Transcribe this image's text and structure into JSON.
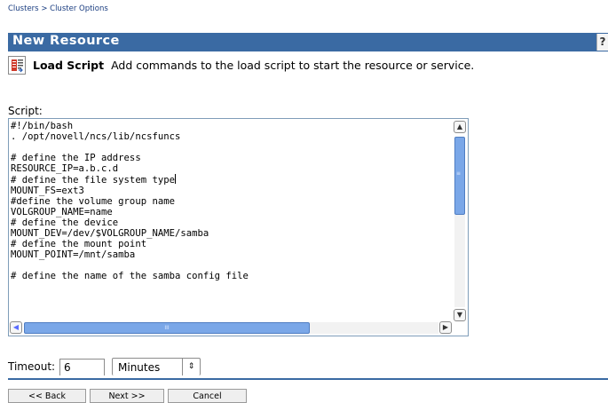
{
  "breadcrumb": {
    "root": "Clusters",
    "separator": ">",
    "current": "Cluster Options"
  },
  "page": {
    "title": "New Resource",
    "help_label": "?"
  },
  "header": {
    "bold": "Load Script",
    "text": "Add commands to the load script to start the resource or service."
  },
  "script": {
    "label": "Script:",
    "lines_before_caret": "#!/bin/bash\n. /opt/novell/ncs/lib/ncsfuncs\n\n# define the IP address\nRESOURCE_IP=a.b.c.d\n# define the file system type",
    "lines_after_caret": "\nMOUNT_FS=ext3\n#define the volume group name\nVOLGROUP_NAME=name\n# define the device\nMOUNT_DEV=/dev/$VOLGROUP_NAME/samba\n# define the mount point\nMOUNT_POINT=/mnt/samba\n\n# define the name of the samba config file"
  },
  "timeout": {
    "label": "Timeout:",
    "value": "6",
    "unit": "Minutes"
  },
  "buttons": {
    "back": "<< Back",
    "next": "Next >>",
    "cancel": "Cancel"
  },
  "colors": {
    "title_bar": "#3a6aa3",
    "breadcrumb_link": "#1a3d80",
    "scroll_thumb": "#7aa7e8"
  }
}
